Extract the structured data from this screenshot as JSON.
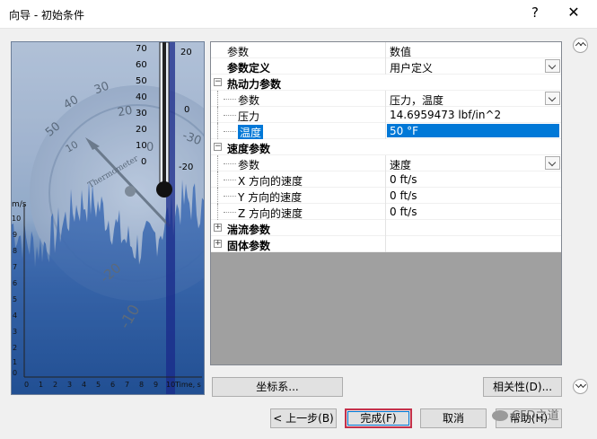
{
  "window": {
    "title": "向导 - 初始条件",
    "help_label": "?",
    "close_label": "✕"
  },
  "art": {
    "thermo_left_ticks": [
      "70",
      "60",
      "50",
      "40",
      "30",
      "20",
      "10",
      "0"
    ],
    "thermo_right_ticks": [
      "20",
      "0",
      "-20"
    ],
    "gauge_labels": [
      "50",
      "40",
      "30",
      "20",
      "10",
      "0",
      "-10",
      "-20",
      "-30",
      "Thermometer"
    ],
    "y_axis_unit": "m/s",
    "y_ticks": [
      "10",
      "9",
      "8",
      "7",
      "6",
      "5",
      "4",
      "3",
      "2",
      "1",
      "0"
    ],
    "x_ticks": [
      "0",
      "1",
      "2",
      "3",
      "4",
      "5",
      "6",
      "7",
      "8",
      "9",
      "10"
    ],
    "x_axis_label": "Time, s"
  },
  "grid": {
    "rows": [
      {
        "name": "参数",
        "value": "数值",
        "type": "header"
      },
      {
        "name": "参数定义",
        "value": "用户定义",
        "type": "top",
        "dropdown": true
      },
      {
        "name": "热动力参数",
        "value": "",
        "type": "group",
        "expander": "−"
      },
      {
        "name": "参数",
        "value": "压力，温度",
        "type": "child",
        "dropdown": true
      },
      {
        "name": "压力",
        "value": "14.6959473 lbf/in^2",
        "type": "child"
      },
      {
        "name": "温度",
        "value": "50 °F",
        "type": "child",
        "selected": true
      },
      {
        "name": "速度参数",
        "value": "",
        "type": "group",
        "expander": "−"
      },
      {
        "name": "参数",
        "value": "速度",
        "type": "child",
        "dropdown": true
      },
      {
        "name": "X 方向的速度",
        "value": "0 ft/s",
        "type": "child"
      },
      {
        "name": "Y 方向的速度",
        "value": "0 ft/s",
        "type": "child"
      },
      {
        "name": "Z 方向的速度",
        "value": "0 ft/s",
        "type": "child"
      },
      {
        "name": "湍流参数",
        "value": "",
        "type": "group",
        "expander": "+"
      },
      {
        "name": "固体参数",
        "value": "",
        "type": "group",
        "expander": "+"
      }
    ]
  },
  "buttons": {
    "coord": "坐标系...",
    "dependency": "相关性(D)...",
    "prev": "< 上一步(B)",
    "finish": "完成(F)",
    "cancel": "取消",
    "help": "帮助(H)"
  },
  "watermark": "CFD之道"
}
